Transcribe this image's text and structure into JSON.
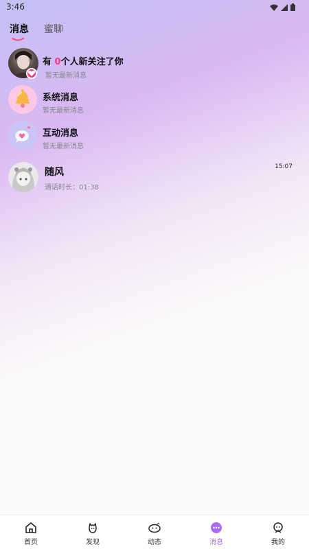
{
  "status": {
    "time": "3:46"
  },
  "tabs": [
    {
      "label": "消息",
      "active": true
    },
    {
      "label": "蜜聊",
      "active": false
    }
  ],
  "messages": [
    {
      "title_prefix": "有 ",
      "count": "0",
      "title_suffix": "个人新关注了你",
      "subtitle": "暂无最新消息",
      "avatar": "user-photo"
    },
    {
      "title": "系统消息",
      "subtitle": "暂无最新消息",
      "avatar": "bell-icon"
    },
    {
      "title": "互动消息",
      "subtitle": "暂无最新消息",
      "avatar": "chat-bubble-heart-icon"
    },
    {
      "title": "随风",
      "subtitle": "通话时长：01:38",
      "time": "15:07",
      "avatar": "anime-girl-avatar"
    }
  ],
  "nav": [
    {
      "label": "首页",
      "icon": "home-icon",
      "active": false
    },
    {
      "label": "发现",
      "icon": "discover-icon",
      "active": false
    },
    {
      "label": "动态",
      "icon": "moments-icon",
      "active": false
    },
    {
      "label": "消息",
      "icon": "message-icon",
      "active": true
    },
    {
      "label": "我的",
      "icon": "profile-icon",
      "active": false
    }
  ],
  "colors": {
    "accent": "#a96ef0",
    "highlight": "#ff3b82"
  }
}
